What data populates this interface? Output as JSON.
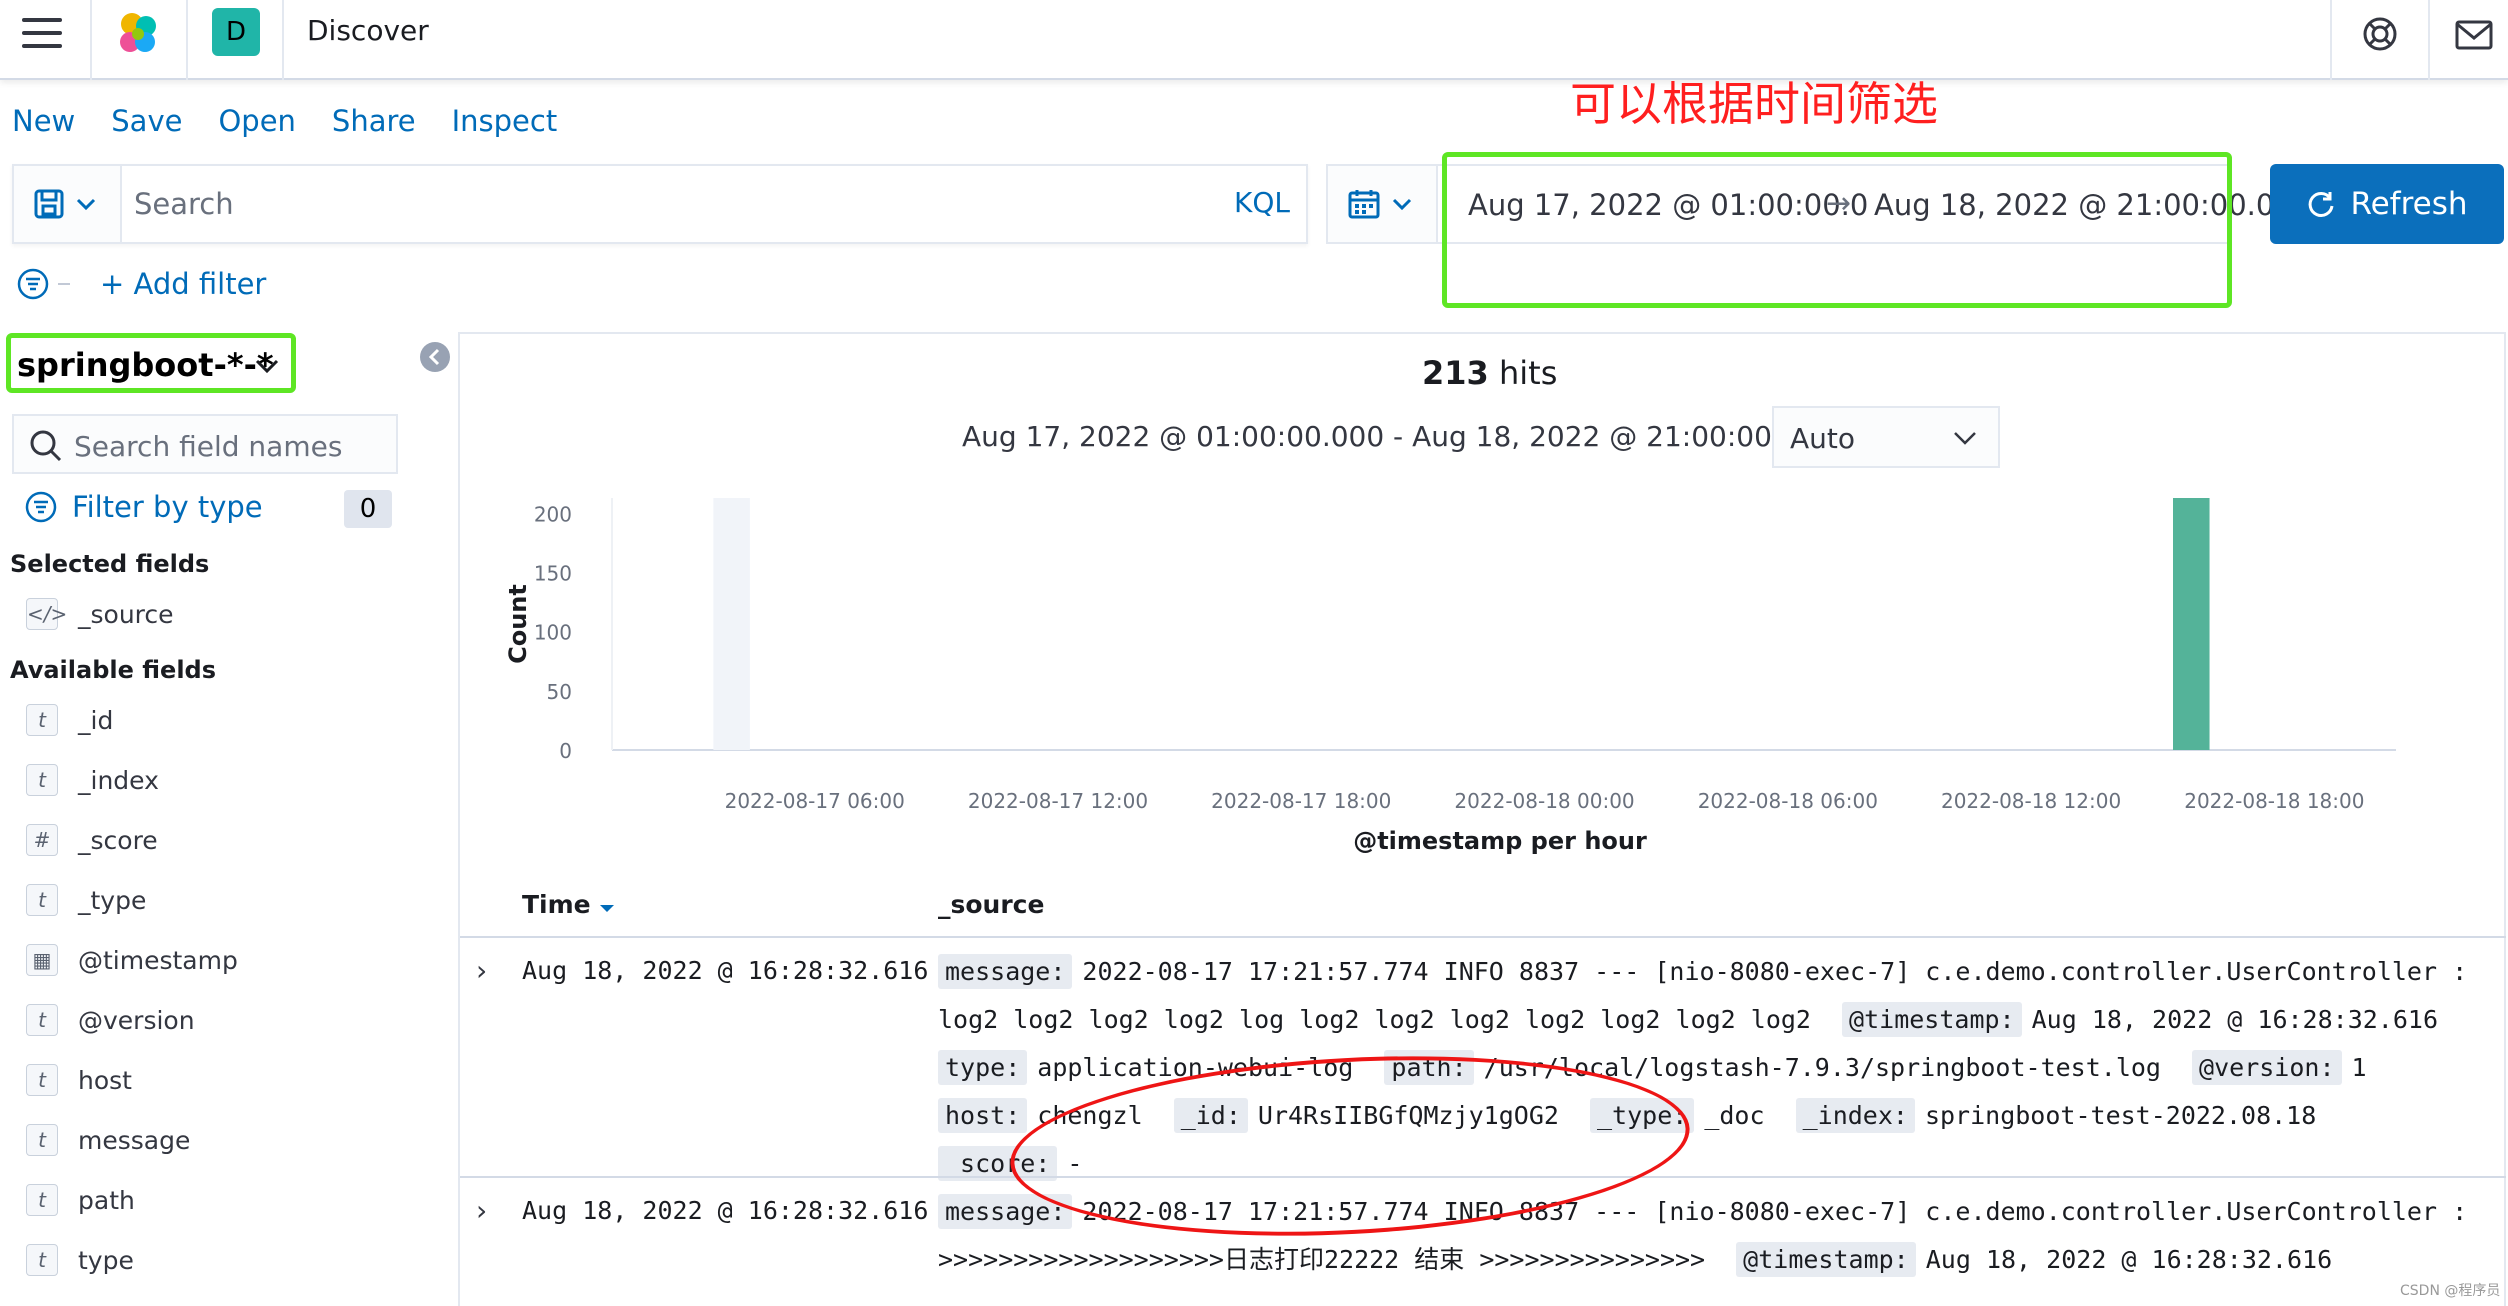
{
  "header": {
    "app_title": "Discover",
    "space_initial": "D",
    "space_color": "#20b5a8",
    "icons": [
      "menu-icon",
      "elastic-logo-icon",
      "help-icon",
      "mail-icon"
    ]
  },
  "menu": {
    "new": "New",
    "save": "Save",
    "open": "Open",
    "share": "Share",
    "inspect": "Inspect"
  },
  "annotation": {
    "time_filter_note": "可以根据时间筛选",
    "highlight_color": "#5ee624",
    "ellipse_color": "#ee1515"
  },
  "query": {
    "placeholder": "Search",
    "language": "KQL"
  },
  "date_range": {
    "start": "Aug 17, 2022 @ 01:00:00.0",
    "end": "Aug 18, 2022 @ 21:00:00.0",
    "arrow": "→"
  },
  "refresh": {
    "label": "Refresh",
    "color": "#0b6fbc"
  },
  "filters": {
    "add_filter": "+ Add filter"
  },
  "sidebar": {
    "index_pattern": "springboot-*-*",
    "field_search_placeholder": "Search field names",
    "filter_by_type": "Filter by type",
    "filter_count": "0",
    "selected_header": "Selected fields",
    "selected_fields": [
      {
        "type_icon": "</>",
        "name": "_source"
      }
    ],
    "available_header": "Available fields",
    "available_fields": [
      {
        "type_icon": "t",
        "name": "_id"
      },
      {
        "type_icon": "t",
        "name": "_index"
      },
      {
        "type_icon": "#",
        "name": "_score"
      },
      {
        "type_icon": "t",
        "name": "_type"
      },
      {
        "type_icon": "▦",
        "name": "@timestamp"
      },
      {
        "type_icon": "t",
        "name": "@version"
      },
      {
        "type_icon": "t",
        "name": "host"
      },
      {
        "type_icon": "t",
        "name": "message"
      },
      {
        "type_icon": "t",
        "name": "path"
      },
      {
        "type_icon": "t",
        "name": "type"
      }
    ]
  },
  "results": {
    "hits_count": "213",
    "hits_label": "hits",
    "range_text": "Aug 17, 2022 @ 01:00:00.000 - Aug 18, 2022 @ 21:00:00.000",
    "interval": "Auto"
  },
  "chart_data": {
    "type": "bar",
    "ylabel": "Count",
    "xlabel": "@timestamp per hour",
    "ylim": [
      0,
      213
    ],
    "y_ticks": [
      "0",
      "50",
      "100",
      "150",
      "200"
    ],
    "x_ticks": [
      "2022-08-17 06:00",
      "2022-08-17 12:00",
      "2022-08-17 18:00",
      "2022-08-18 00:00",
      "2022-08-18 06:00",
      "2022-08-18 12:00",
      "2022-08-18 18:00"
    ],
    "x_range_hours": [
      1,
      45
    ],
    "bars": [
      {
        "hour_offset": 16,
        "timestamp": "2022-08-18 16:00",
        "value": 213
      }
    ],
    "bar_color": "#54b399",
    "highlight_hour_offset": 4,
    "grid": false
  },
  "table": {
    "col_time": "Time",
    "col_source": "_source",
    "rows": [
      {
        "time": "Aug 18, 2022 @ 16:28:32.616",
        "fields": [
          {
            "k": "message:",
            "v": "2022-08-17 17:21:57.774 INFO 8837 --- [nio-8080-exec-7] c.e.demo.controller.UserController : log2 log2 log2 log2 log log2 log2 log2 log2 log2 log2 log2"
          },
          {
            "k": "@timestamp:",
            "v": "Aug 18, 2022 @ 16:28:32.616"
          },
          {
            "k": "type:",
            "v": "application-webui-log"
          },
          {
            "k": "path:",
            "v": "/usr/local/logstash-7.9.3/springboot-test.log"
          },
          {
            "k": "@version:",
            "v": "1"
          },
          {
            "k": "host:",
            "v": "chengzl"
          },
          {
            "k": "_id:",
            "v": "Ur4RsIIBGfQMzjy1gOG2"
          },
          {
            "k": "_type:",
            "v": "_doc"
          },
          {
            "k": "_index:",
            "v": "springboot-test-2022.08.18"
          },
          {
            "k": "_score:",
            "v": "-"
          }
        ]
      },
      {
        "time": "Aug 18, 2022 @ 16:28:32.616",
        "fields": [
          {
            "k": "message:",
            "v": "2022-08-17 17:21:57.774 INFO 8837 --- [nio-8080-exec-7] c.e.demo.controller.UserController : >>>>>>>>>>>>>>>>>>>日志打印22222 结束 >>>>>>>>>>>>>>>"
          },
          {
            "k": "@timestamp:",
            "v": "Aug 18, 2022 @ 16:28:32.616"
          }
        ]
      }
    ]
  },
  "watermark": "CSDN @程序员"
}
